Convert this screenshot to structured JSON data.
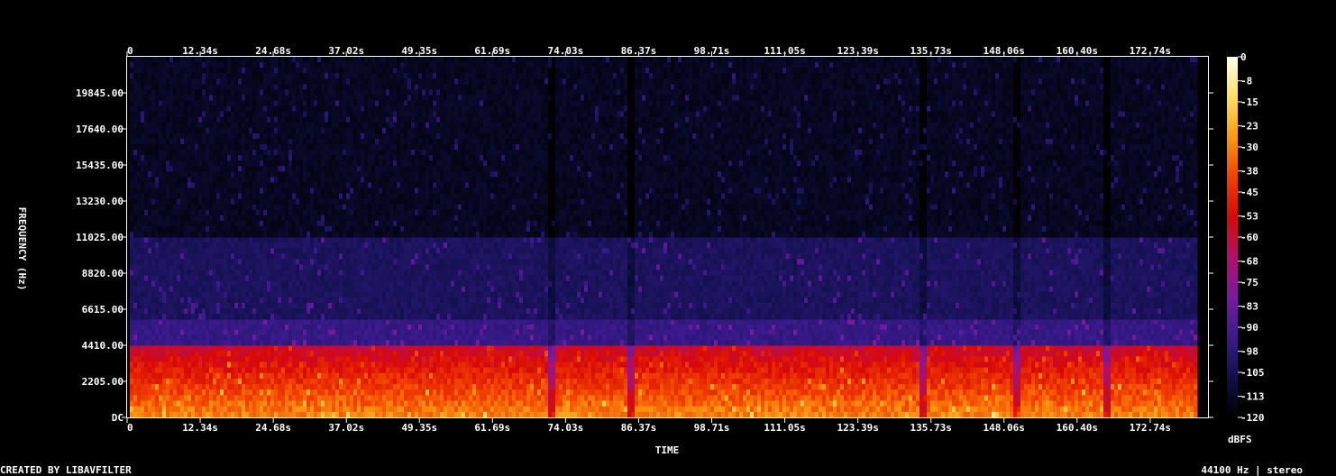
{
  "chart_data": {
    "type": "heatmap",
    "xlabel": "TIME",
    "ylabel": "FREQUENCY (Hz)",
    "colorbar_label": "dBFS",
    "x_ticks": [
      "0",
      "12.34s",
      "24.68s",
      "37.02s",
      "49.35s",
      "61.69s",
      "74.03s",
      "86.37s",
      "98.71s",
      "111.05s",
      "123.39s",
      "135.73s",
      "148.06s",
      "160.40s",
      "172.74s"
    ],
    "x_tick_values": [
      0,
      12.34,
      24.68,
      37.02,
      49.35,
      61.69,
      74.03,
      86.37,
      98.71,
      111.05,
      123.39,
      135.73,
      148.06,
      160.4,
      172.74
    ],
    "x_range": [
      0,
      182.5
    ],
    "y_ticks": [
      "DC",
      "2205.00",
      "4410.00",
      "6615.00",
      "8820.00",
      "11025.00",
      "13230.00",
      "15435.00",
      "17640.00",
      "19845.00"
    ],
    "y_tick_values": [
      0,
      2205,
      4410,
      6615,
      8820,
      11025,
      13230,
      15435,
      17640,
      19845
    ],
    "y_range": [
      0,
      22050
    ],
    "colorbar_ticks": [
      "0",
      "-8",
      "-15",
      "-23",
      "-30",
      "-38",
      "-45",
      "-53",
      "-60",
      "-68",
      "-75",
      "-83",
      "-90",
      "-98",
      "-105",
      "-113",
      "-120"
    ],
    "colorbar_range": [
      -120,
      0
    ],
    "colormap_stops": [
      "#000000",
      "#10104a",
      "#3a1a8c",
      "#7a1aa0",
      "#b0106a",
      "#d80808",
      "#f24000",
      "#fb9a10",
      "#ffe060",
      "#fffff0"
    ],
    "spectral_bands_hz": [
      {
        "from": 0,
        "to": 4410,
        "level_dbfs": -45
      },
      {
        "from": 4410,
        "to": 6000,
        "level_dbfs": -95
      },
      {
        "from": 6000,
        "to": 11025,
        "level_dbfs": -103
      },
      {
        "from": 11025,
        "to": 22050,
        "level_dbfs": -114
      }
    ],
    "quiet_gaps_s": [
      71.5,
      85.0,
      134.0,
      150.0,
      165.0
    ]
  },
  "footer": {
    "created_by": "CREATED BY LIBAVFILTER",
    "sample_info": "44100 Hz | stereo"
  }
}
